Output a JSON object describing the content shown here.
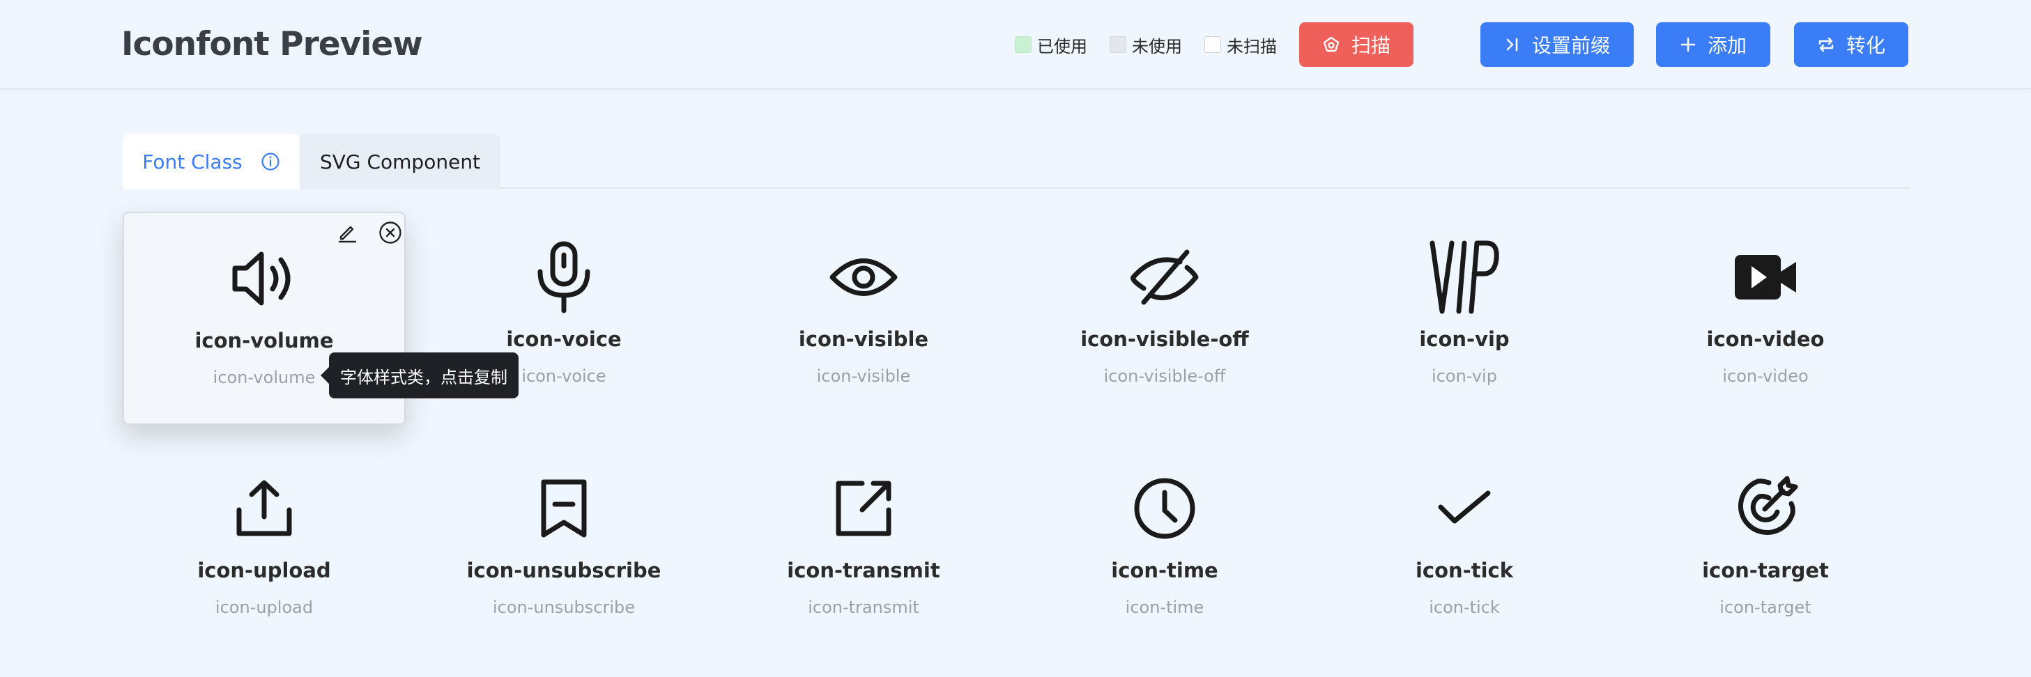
{
  "header": {
    "title": "Iconfont Preview",
    "legend": [
      {
        "label": "已使用",
        "color": "#c9f0d3"
      },
      {
        "label": "未使用",
        "color": "#e3e6ea"
      },
      {
        "label": "未扫描",
        "color": "#ffffff"
      }
    ],
    "buttons": {
      "scan": {
        "label": "扫描",
        "icon": "scan-icon",
        "color": "#f0605a"
      },
      "prefix": {
        "label": "设置前缀",
        "icon": "prefix-icon",
        "color": "#3a7df6"
      },
      "add": {
        "label": "添加",
        "icon": "plus-icon",
        "color": "#3a7df6"
      },
      "convert": {
        "label": "转化",
        "icon": "convert-icon",
        "color": "#3a7df6"
      }
    }
  },
  "tabs": [
    {
      "label": "Font Class",
      "active": true,
      "icon": "info-icon"
    },
    {
      "label": "SVG Component",
      "active": false
    }
  ],
  "icons": [
    {
      "name": "icon-volume",
      "class": "icon-volume",
      "icon": "volume-icon"
    },
    {
      "name": "icon-voice",
      "class": "icon-voice",
      "icon": "microphone-icon"
    },
    {
      "name": "icon-visible",
      "class": "icon-visible",
      "icon": "eye-icon"
    },
    {
      "name": "icon-visible-off",
      "class": "icon-visible-off",
      "icon": "eye-off-icon"
    },
    {
      "name": "icon-vip",
      "class": "icon-vip",
      "icon": "vip-icon",
      "glyph_text": "VIP"
    },
    {
      "name": "icon-video",
      "class": "icon-video",
      "icon": "video-icon"
    },
    {
      "name": "icon-upload",
      "class": "icon-upload",
      "icon": "upload-icon"
    },
    {
      "name": "icon-unsubscribe",
      "class": "icon-unsubscribe",
      "icon": "unsubscribe-icon"
    },
    {
      "name": "icon-transmit",
      "class": "icon-transmit",
      "icon": "transmit-icon"
    },
    {
      "name": "icon-time",
      "class": "icon-time",
      "icon": "clock-icon"
    },
    {
      "name": "icon-tick",
      "class": "icon-tick",
      "icon": "tick-icon"
    },
    {
      "name": "icon-target",
      "class": "icon-target",
      "icon": "target-icon"
    }
  ],
  "tooltip": {
    "text": "字体样式类，点击复制"
  }
}
